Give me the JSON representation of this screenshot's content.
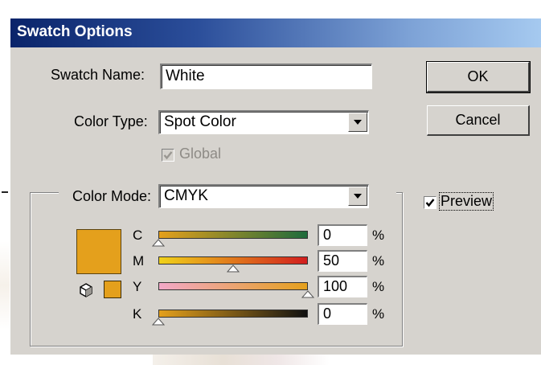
{
  "dialog": {
    "title": "Swatch Options",
    "swatch_name_label": "Swatch Name:",
    "swatch_name_value": "White",
    "color_type_label": "Color Type:",
    "color_type_value": "Spot Color",
    "global_label": "Global",
    "global_checked": true,
    "global_enabled": false,
    "color_mode_label": "Color Mode:",
    "color_mode_value": "CMYK",
    "preview_label": "Preview",
    "preview_checked": true,
    "ok_label": "OK",
    "cancel_label": "Cancel",
    "swatch_color": "#e4a01c",
    "icons": {
      "dropdown": "chevron-down-icon",
      "checkmark": "check-icon",
      "gamut": "cube-icon"
    }
  },
  "sliders": [
    {
      "label": "C",
      "value": "0",
      "unit": "%",
      "fraction": 0.0,
      "gradient": [
        "#e4a01c",
        "#1f6b3c"
      ]
    },
    {
      "label": "M",
      "value": "50",
      "unit": "%",
      "fraction": 0.5,
      "gradient": [
        "#f0d21a",
        "#d21e1e"
      ]
    },
    {
      "label": "Y",
      "value": "100",
      "unit": "%",
      "fraction": 1.0,
      "gradient": [
        "#f2a8c8",
        "#e4a01c"
      ]
    },
    {
      "label": "K",
      "value": "0",
      "unit": "%",
      "fraction": 0.0,
      "gradient": [
        "#e4a01c",
        "#111111"
      ]
    }
  ]
}
